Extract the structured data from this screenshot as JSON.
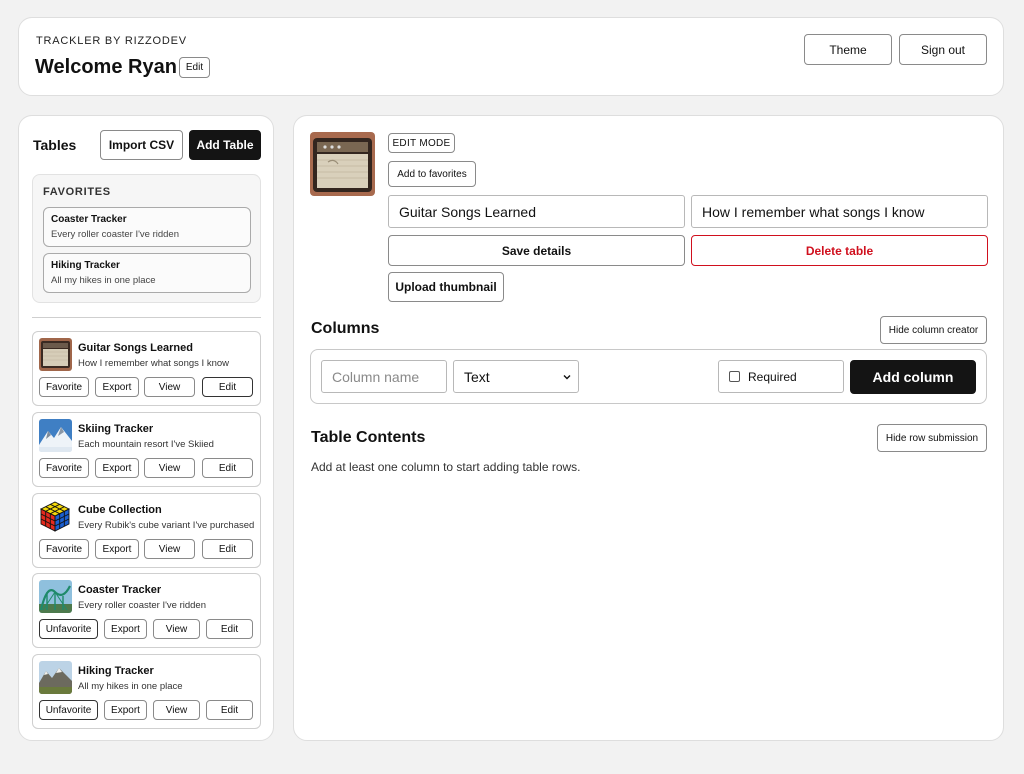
{
  "header": {
    "eyebrow": "TRACKLER BY RIZZODEV",
    "welcome": "Welcome Ryan",
    "edit_label": "Edit",
    "theme_label": "Theme",
    "signout_label": "Sign out"
  },
  "sidebar": {
    "title": "Tables",
    "import_label": "Import CSV",
    "add_label": "Add Table",
    "favorites_heading": "FAVORITES",
    "favorites": [
      {
        "title": "Coaster Tracker",
        "desc": "Every roller coaster I've ridden"
      },
      {
        "title": "Hiking Tracker",
        "desc": "All my hikes in one place"
      }
    ],
    "tables": [
      {
        "title": "Guitar Songs Learned",
        "desc": "How I remember what songs I know",
        "fav_label": "Favorite",
        "export_label": "Export",
        "view_label": "View",
        "edit_label": "Edit",
        "thumb": "amp-icon"
      },
      {
        "title": "Skiing Tracker",
        "desc": "Each mountain resort I've Skiied",
        "fav_label": "Favorite",
        "export_label": "Export",
        "view_label": "View",
        "edit_label": "Edit",
        "thumb": "mountain-snow-icon"
      },
      {
        "title": "Cube Collection",
        "desc": "Every Rubik's cube variant I've purchased",
        "fav_label": "Favorite",
        "export_label": "Export",
        "view_label": "View",
        "edit_label": "Edit",
        "thumb": "rubiks-cube-icon"
      },
      {
        "title": "Coaster Tracker",
        "desc": "Every roller coaster I've ridden",
        "fav_label": "Unfavorite",
        "export_label": "Export",
        "view_label": "View",
        "edit_label": "Edit",
        "thumb": "roller-coaster-icon"
      },
      {
        "title": "Hiking Tracker",
        "desc": "All my hikes in one place",
        "fav_label": "Unfavorite",
        "export_label": "Export",
        "view_label": "View",
        "edit_label": "Edit",
        "thumb": "mountains-icon"
      }
    ]
  },
  "main": {
    "edit_mode_label": "EDIT MODE",
    "add_fav_label": "Add to favorites",
    "name_value": "Guitar Songs Learned",
    "desc_value": "How I remember what songs I know",
    "save_label": "Save details",
    "delete_label": "Delete table",
    "upload_label": "Upload thumbnail",
    "columns_title": "Columns",
    "hide_creator_label": "Hide column creator",
    "column_name_placeholder": "Column name",
    "type_value": "Text",
    "required_label": "Required",
    "add_column_label": "Add column",
    "contents_title": "Table Contents",
    "hide_row_label": "Hide row submission",
    "empty_message": "Add at least one column to start adding table rows."
  },
  "colors": {
    "accent_dark": "#141414",
    "danger": "#d0101e",
    "background": "#f2f2f2"
  }
}
